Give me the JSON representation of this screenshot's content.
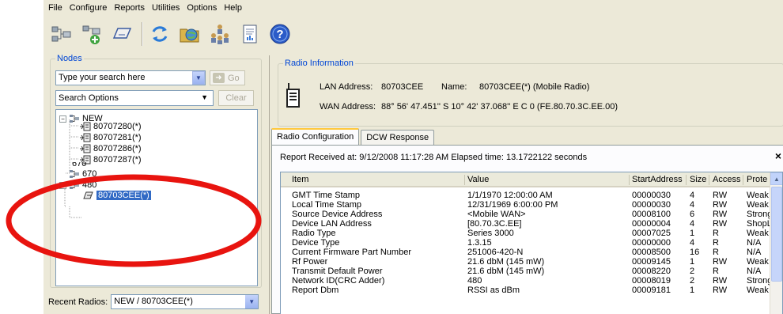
{
  "menu": [
    "File",
    "Configure",
    "Reports",
    "Utilities",
    "Options",
    "Help"
  ],
  "toolbar": {
    "icons": [
      "network-add-icon",
      "network-plus-icon",
      "card-icon",
      "refresh-icon",
      "folder-icon",
      "hierarchy-icon",
      "report-icon",
      "help-icon"
    ]
  },
  "nodes": {
    "title": "Nodes",
    "search_value": "Type your search here",
    "go_label": "Go",
    "options_label": "Search Options",
    "clear_label": "Clear",
    "tree": {
      "root": "NEW",
      "children": [
        "80707280(*)",
        "80707281(*)",
        "80707286(*)",
        "80707287(*)"
      ],
      "partial": "670",
      "n670": "670",
      "n480": "480",
      "selected": "80703CEE(*)"
    },
    "recent_label": "Recent Radios:",
    "recent_value": "NEW / 80703CEE(*)"
  },
  "radio_info": {
    "title": "Radio Information",
    "lan_label": "LAN Address:",
    "lan_value": "80703CEE",
    "name_label": "Name:",
    "name_value": "80703CEE(*) (Mobile Radio)",
    "wan_label": "WAN Address:",
    "wan_value": "88° 56' 47.451'' S 10° 42' 37.068'' E C 0 (FE.80.70.3C.EE.00)"
  },
  "tabs": [
    "Radio Configuration",
    "DCW Response"
  ],
  "report": "Report Received at: 9/12/2008 11:17:28 AM Elapsed time: 13.1722122 seconds",
  "close_label": "×",
  "grid": {
    "headers": [
      "Item",
      "Value",
      "StartAddress",
      "Size",
      "Access",
      "Prote"
    ],
    "rows": [
      [
        "GMT Time Stamp",
        "1/1/1970 12:00:00 AM",
        "00000030",
        "4",
        "RW",
        "Weak"
      ],
      [
        "Local Time Stamp",
        "12/31/1969 6:00:00 PM",
        "00000030",
        "4",
        "RW",
        "Weak"
      ],
      [
        "Source Device Address",
        "<Mobile WAN>",
        "00008100",
        "6",
        "RW",
        "Strong"
      ],
      [
        "Device LAN Address",
        "[80.70.3C.EE]",
        "00000004",
        "4",
        "RW",
        "ShopL"
      ],
      [
        "Radio Type",
        "Series 3000",
        "00007025",
        "1",
        "R",
        "Weak"
      ],
      [
        "Device Type",
        "1.3.15",
        "00000000",
        "4",
        "R",
        "N/A"
      ],
      [
        "Current Firmware Part Number",
        "251006-420-N",
        "00008500",
        "16",
        "R",
        "N/A"
      ],
      [
        "Rf Power",
        "21.6 dbM (145 mW)",
        "00009145",
        "1",
        "RW",
        "Weak"
      ],
      [
        "Transmit Default Power",
        "21.6 dbM (145 mW)",
        "00008220",
        "2",
        "R",
        "N/A"
      ],
      [
        "Network ID(CRC Adder)",
        "480",
        "00008019",
        "2",
        "RW",
        "Strong"
      ],
      [
        "Report Dbm",
        "RSSI as dBm",
        "00009181",
        "1",
        "RW",
        "Weak"
      ]
    ]
  },
  "colors": {
    "selection": "#316ac5",
    "group_title": "#0046d5",
    "annotation": "#e8140f"
  }
}
